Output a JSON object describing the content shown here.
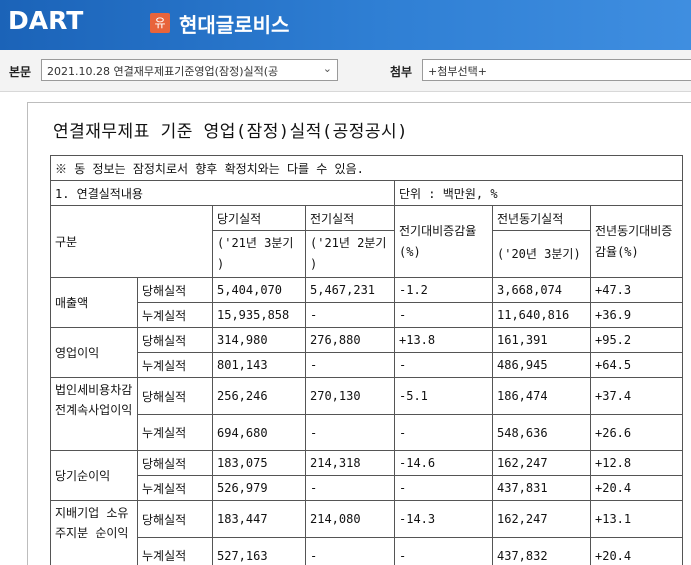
{
  "header": {
    "logo": "DART",
    "badge": "유",
    "company": "현대글로비스"
  },
  "toolbar": {
    "report_label": "본문",
    "report_value": "2021.10.28  연결재무제표기준영업(잠정)실적(공",
    "attach_label": "첨부",
    "attach_value": "+첨부선택+"
  },
  "doc": {
    "title": "연결재무제표 기준 영업(잠정)실적(공정공시)",
    "notice": "※ 동 정보는 잠정치로서 향후 확정치와는 다를 수 있음.",
    "section": "1. 연결실적내용",
    "unit": "단위 : 백만원, %",
    "headers": {
      "category": "구분",
      "current": "당기실적",
      "current_period": "('21년 3분기 )",
      "prev": "전기실적",
      "prev_period": "('21년 2분기 )",
      "qoq": "전기대비증감율(%)",
      "yoy_base": "전년동기실적",
      "yoy_period": "('20년 3분기)",
      "yoy": "전년동기대비증감율(%)"
    },
    "groups": [
      {
        "name": "매출액",
        "rows": [
          {
            "type": "당해실적",
            "current": "5,404,070",
            "prev": "5,467,231",
            "qoq": "-1.2",
            "yoy_base": "3,668,074",
            "yoy": "+47.3"
          },
          {
            "type": "누계실적",
            "current": "15,935,858",
            "prev": "-",
            "qoq": "-",
            "yoy_base": "11,640,816",
            "yoy": "+36.9"
          }
        ]
      },
      {
        "name": "영업이익",
        "rows": [
          {
            "type": "당해실적",
            "current": "314,980",
            "prev": "276,880",
            "qoq": "+13.8",
            "yoy_base": "161,391",
            "yoy": "+95.2"
          },
          {
            "type": "누계실적",
            "current": "801,143",
            "prev": "-",
            "qoq": "-",
            "yoy_base": "486,945",
            "yoy": "+64.5"
          }
        ]
      },
      {
        "name": "법인세비용차감전계속사업이익",
        "rows": [
          {
            "type": "당해실적",
            "current": "256,246",
            "prev": "270,130",
            "qoq": "-5.1",
            "yoy_base": "186,474",
            "yoy": "+37.4"
          },
          {
            "type": "누계실적",
            "current": "694,680",
            "prev": "-",
            "qoq": "-",
            "yoy_base": "548,636",
            "yoy": "+26.6"
          }
        ]
      },
      {
        "name": "당기순이익",
        "rows": [
          {
            "type": "당해실적",
            "current": "183,075",
            "prev": "214,318",
            "qoq": "-14.6",
            "yoy_base": "162,247",
            "yoy": "+12.8"
          },
          {
            "type": "누계실적",
            "current": "526,979",
            "prev": "-",
            "qoq": "-",
            "yoy_base": "437,831",
            "yoy": "+20.4"
          }
        ]
      },
      {
        "name": "지배기업 소유주지분 순이익",
        "rows": [
          {
            "type": "당해실적",
            "current": "183,447",
            "prev": "214,080",
            "qoq": "-14.3",
            "yoy_base": "162,247",
            "yoy": "+13.1"
          },
          {
            "type": "누계실적",
            "current": "527,163",
            "prev": "-",
            "qoq": "-",
            "yoy_base": "437,832",
            "yoy": "+20.4"
          }
        ]
      }
    ]
  }
}
